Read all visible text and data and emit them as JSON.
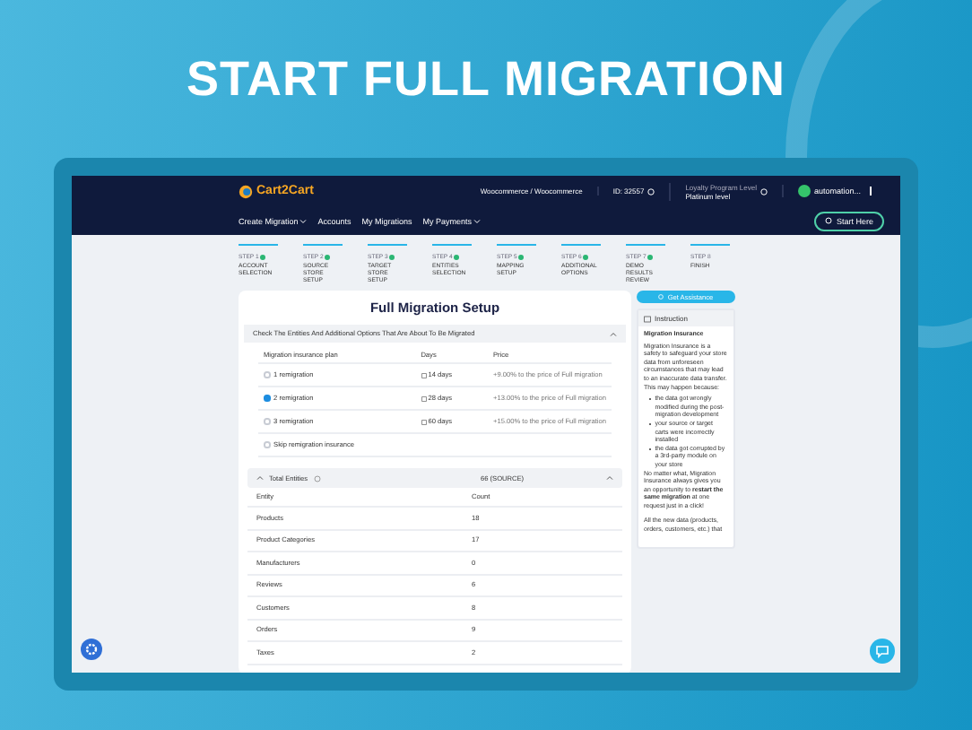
{
  "headline": "START FULL MIGRATION",
  "header": {
    "logo": "Cart2Cart",
    "store_pair": "Woocommerce / Woocommerce",
    "account_id": "ID: 32557",
    "loyalty_label": "Loyalty Program Level",
    "loyalty_value": "Platinum level",
    "user": "automation...",
    "nav": [
      {
        "label": "Create Migration",
        "dropdown": true
      },
      {
        "label": "Accounts",
        "dropdown": false
      },
      {
        "label": "My Migrations",
        "dropdown": false
      },
      {
        "label": "My Payments",
        "dropdown": true
      }
    ],
    "start_button": "Start Here"
  },
  "steps": [
    {
      "number": "STEP 1",
      "label": "ACCOUNT SELECTION",
      "completed": true
    },
    {
      "number": "STEP 2",
      "label": "SOURCE STORE SETUP",
      "completed": true
    },
    {
      "number": "STEP 3",
      "label": "TARGET STORE SETUP",
      "completed": true
    },
    {
      "number": "STEP 4",
      "label": "ENTITIES SELECTION",
      "completed": true
    },
    {
      "number": "STEP 5",
      "label": "MAPPING SETUP",
      "completed": true
    },
    {
      "number": "STEP 6",
      "label": "ADDITIONAL OPTIONS",
      "completed": true
    },
    {
      "number": "STEP 7",
      "label": "DEMO RESULTS REVIEW",
      "completed": true
    },
    {
      "number": "STEP 8",
      "label": "FINISH",
      "completed": false
    }
  ],
  "setup": {
    "title": "Full Migration Setup",
    "section": "Check The Entities And Additional Options That Are About To Be Migrated",
    "insurance_columns": [
      "Migration insurance plan",
      "Days",
      "Price"
    ],
    "insurance_plans": [
      {
        "plan": "1 remigration",
        "days": "14 days",
        "price": "+9.00% to the price of Full migration",
        "selected": false
      },
      {
        "plan": "2 remigration",
        "days": "28 days",
        "price": "+13.00% to the price of Full migration",
        "selected": true
      },
      {
        "plan": "3 remigration",
        "days": "60 days",
        "price": "+15.00% to the price of Full migration",
        "selected": false
      },
      {
        "plan": "Skip remigration insurance",
        "selected": false
      }
    ],
    "total_label": "Total Entities",
    "total_value": "66 (SOURCE)",
    "entity_columns": [
      "Entity",
      "Count"
    ],
    "entities": [
      {
        "entity": "Products",
        "count": "18"
      },
      {
        "entity": "Product Categories",
        "count": "17"
      },
      {
        "entity": "Manufacturers",
        "count": "0"
      },
      {
        "entity": "Reviews",
        "count": "6"
      },
      {
        "entity": "Customers",
        "count": "8"
      },
      {
        "entity": "Orders",
        "count": "9"
      },
      {
        "entity": "Taxes",
        "count": "2"
      }
    ]
  },
  "sidebar": {
    "assist_button": "Get Assistance",
    "panel_title": "Instruction",
    "heading": "Migration Insurance",
    "intro": "Migration Insurance is a safety to safeguard your store data from unforeseen circumstances that may lead to an inaccurate data transfer. This may happen because:",
    "bullets": [
      "the data got wrongly modified during the post-migration development",
      "your source or target carts were incorrectly installed",
      "the data got corrupted by a 3rd-party module on your store"
    ],
    "note": "No matter what, Migration Insurance always gives you an opportunity to **restart the same migration** at one request just in a click!",
    "more": "All the new data (products, orders, customers, etc.) that"
  }
}
